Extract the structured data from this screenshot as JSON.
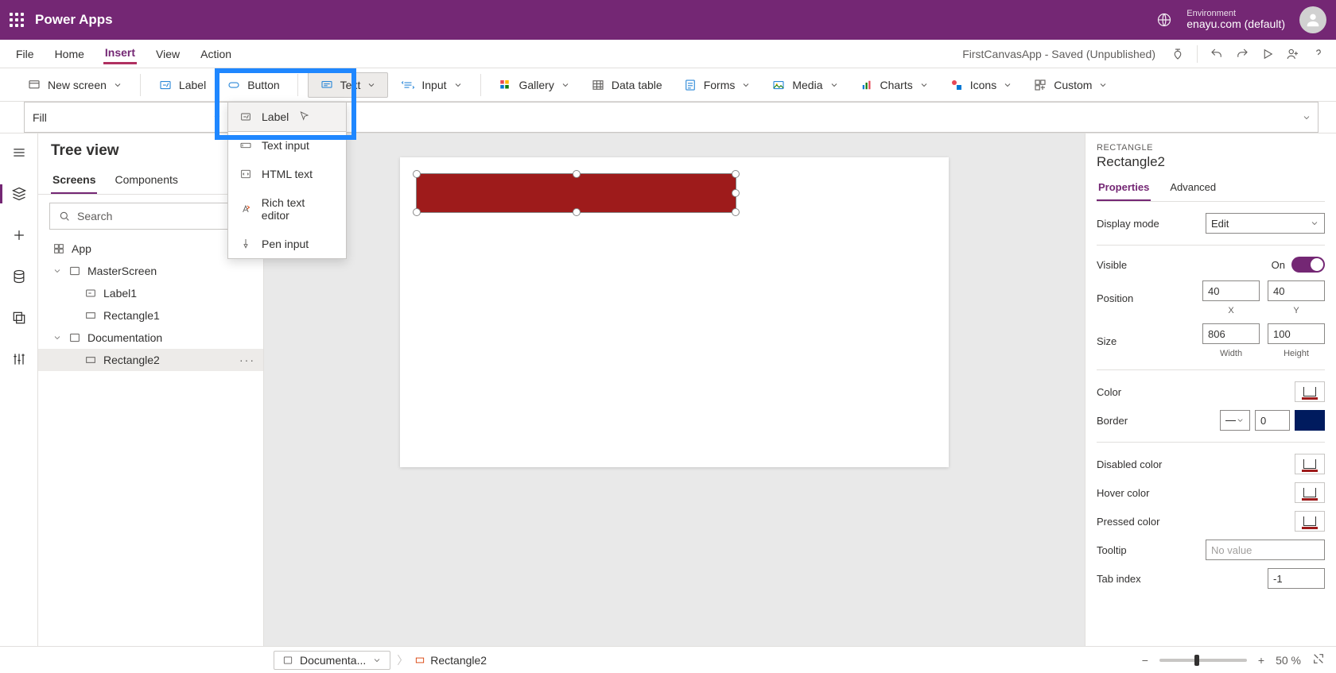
{
  "brand": {
    "title": "Power Apps",
    "env_label": "Environment",
    "env_value": "enayu.com (default)"
  },
  "menubar": {
    "items": [
      "File",
      "Home",
      "Insert",
      "View",
      "Action"
    ],
    "active_index": 2,
    "app_status": "FirstCanvasApp - Saved (Unpublished)"
  },
  "ribbon": {
    "new_screen": "New screen",
    "label": "Label",
    "button": "Button",
    "text": "Text",
    "input": "Input",
    "gallery": "Gallery",
    "data_table": "Data table",
    "forms": "Forms",
    "media": "Media",
    "charts": "Charts",
    "icons": "Icons",
    "custom": "Custom"
  },
  "text_dropdown": {
    "items": [
      "Label",
      "Text input",
      "HTML text",
      "Rich text editor",
      "Pen input"
    ],
    "highlighted_index": 0
  },
  "formula": {
    "property": "Fill",
    "value": ""
  },
  "treeview": {
    "title": "Tree view",
    "tabs": [
      "Screens",
      "Components"
    ],
    "active_tab": 0,
    "search_placeholder": "Search",
    "nodes": {
      "app": "App",
      "master": "MasterScreen",
      "master_children": [
        "Label1",
        "Rectangle1"
      ],
      "doc": "Documentation",
      "doc_children": [
        "Rectangle2"
      ],
      "selected": "Rectangle2"
    }
  },
  "breadcrumb": {
    "screen": "Documenta...",
    "control": "Rectangle2"
  },
  "zoom": {
    "value": "50",
    "unit": "%"
  },
  "props": {
    "category": "RECTANGLE",
    "name": "Rectangle2",
    "tabs": [
      "Properties",
      "Advanced"
    ],
    "active_tab": 0,
    "display_mode_label": "Display mode",
    "display_mode_value": "Edit",
    "visible_label": "Visible",
    "visible_on": "On",
    "position_label": "Position",
    "position_x": "40",
    "position_y": "40",
    "x_label": "X",
    "y_label": "Y",
    "size_label": "Size",
    "size_w": "806",
    "size_h": "100",
    "w_label": "Width",
    "h_label": "Height",
    "color_label": "Color",
    "border_label": "Border",
    "border_width": "0",
    "disabled_color_label": "Disabled color",
    "hover_color_label": "Hover color",
    "pressed_color_label": "Pressed color",
    "tooltip_label": "Tooltip",
    "tooltip_placeholder": "No value",
    "tabindex_label": "Tab index",
    "tabindex_value": "-1"
  },
  "colors": {
    "rect_fill": "#9e1b1b",
    "border_color": "#001b5e"
  }
}
